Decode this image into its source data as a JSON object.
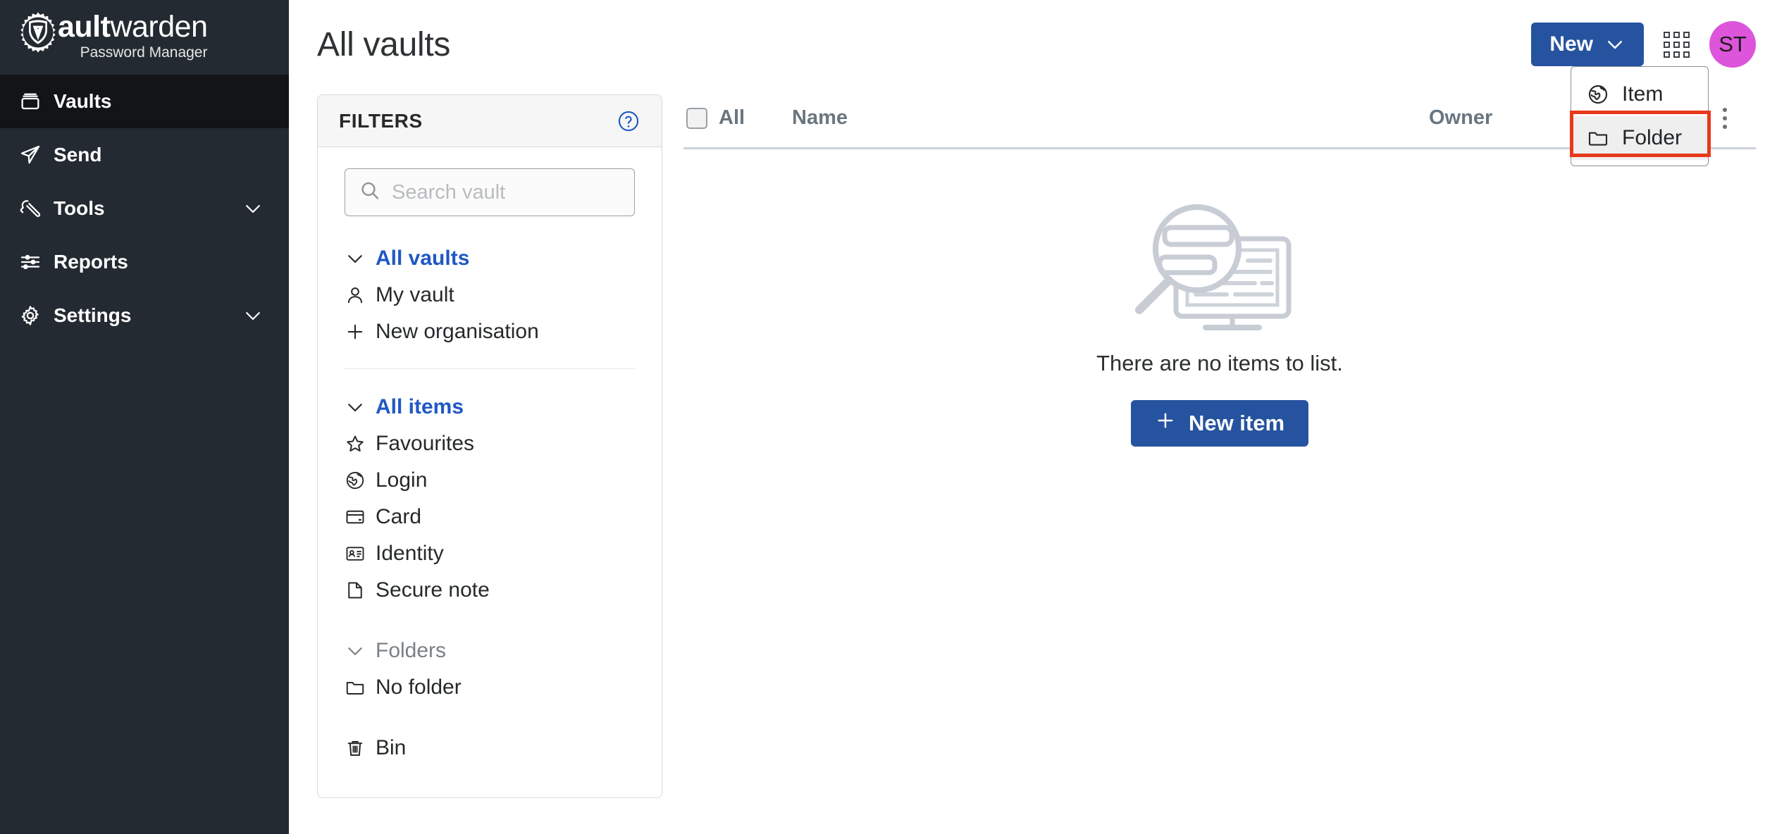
{
  "brand": {
    "name_bold": "ault",
    "name_light": "warden",
    "tagline": "Password Manager",
    "logo_letter": "V"
  },
  "sidebar": {
    "items": [
      {
        "label": "Vaults",
        "icon": "vault-icon",
        "active": true,
        "chevron": false
      },
      {
        "label": "Send",
        "icon": "send-icon",
        "active": false,
        "chevron": false
      },
      {
        "label": "Tools",
        "icon": "wrench-icon",
        "active": false,
        "chevron": true
      },
      {
        "label": "Reports",
        "icon": "sliders-icon",
        "active": false,
        "chevron": false
      },
      {
        "label": "Settings",
        "icon": "gear-icon",
        "active": false,
        "chevron": true
      }
    ]
  },
  "header": {
    "title": "All vaults",
    "new_button_label": "New",
    "avatar_initials": "ST"
  },
  "new_menu": {
    "items": [
      {
        "label": "Item",
        "icon": "globe-icon",
        "highlighted": false
      },
      {
        "label": "Folder",
        "icon": "folder-icon",
        "highlighted": true
      }
    ]
  },
  "filters": {
    "title": "FILTERS",
    "help_icon": "question-circle-icon",
    "search": {
      "placeholder": "Search vault",
      "value": ""
    },
    "vault_group": [
      {
        "label": "All vaults",
        "icon": "chevron-down-icon",
        "style": "header"
      },
      {
        "label": "My vault",
        "icon": "user-icon",
        "style": "normal"
      },
      {
        "label": "New organisation",
        "icon": "plus-icon",
        "style": "normal"
      }
    ],
    "item_group": [
      {
        "label": "All items",
        "icon": "chevron-down-icon",
        "style": "header"
      },
      {
        "label": "Favourites",
        "icon": "star-icon",
        "style": "normal"
      },
      {
        "label": "Login",
        "icon": "globe-icon",
        "style": "normal"
      },
      {
        "label": "Card",
        "icon": "card-icon",
        "style": "normal"
      },
      {
        "label": "Identity",
        "icon": "identity-icon",
        "style": "normal"
      },
      {
        "label": "Secure note",
        "icon": "note-icon",
        "style": "normal"
      }
    ],
    "folder_group": [
      {
        "label": "Folders",
        "icon": "chevron-down-icon",
        "style": "muted-header"
      },
      {
        "label": "No folder",
        "icon": "folder-icon",
        "style": "normal"
      }
    ],
    "bin_group": [
      {
        "label": "Bin",
        "icon": "trash-icon",
        "style": "normal"
      }
    ]
  },
  "table": {
    "columns": {
      "select_all": "All",
      "name": "Name",
      "owner": "Owner"
    },
    "rows": [],
    "empty_message": "There are no items to list.",
    "empty_action_label": "New item"
  },
  "colors": {
    "sidebar_bg": "#232a31",
    "sidebar_active_bg": "#121418",
    "accent_blue": "#26539f",
    "link_blue": "#1f58c4",
    "avatar_bg": "#dd55da",
    "highlight_red": "#e8391b",
    "muted_text": "#7a8187",
    "header_text": "#697680"
  }
}
